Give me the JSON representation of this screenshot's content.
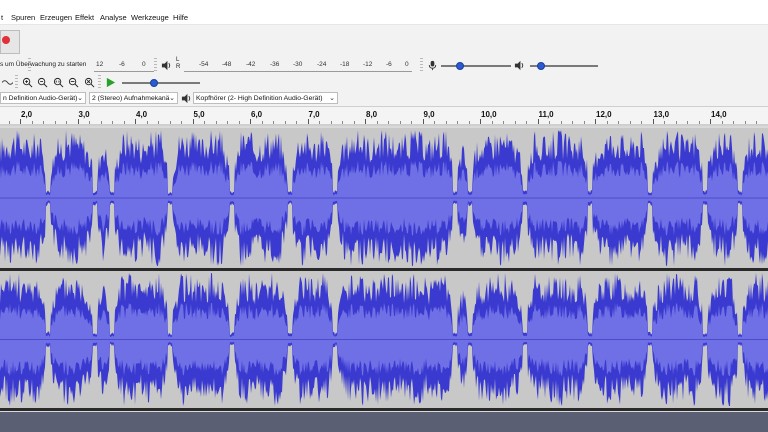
{
  "menu": {
    "items": [
      "t",
      "Spuren",
      "Erzeugen",
      "Effekt",
      "Analyse",
      "Werkzeuge",
      "Hilfe"
    ]
  },
  "meter": {
    "monitor_hint": "s um Überwachung zu starten",
    "record_ticks": [
      "12",
      "-6",
      "0"
    ],
    "playback_ticks": [
      "-54",
      "-48",
      "-42",
      "-36",
      "-30",
      "-24",
      "-18",
      "-12",
      "-6",
      "0"
    ],
    "lr_labels": [
      "L",
      "R"
    ]
  },
  "sliders": {
    "record_volume": 0.25,
    "playback_volume": 0.15,
    "play_speed": 0.4
  },
  "device": {
    "recording_device": "n Definition Audio-Gerät)",
    "channels": "2 (Stereo) Aufnahmekanä",
    "playback_device": "Kopfhörer (2- High Definition Audio-Gerät)"
  },
  "ruler": {
    "labels": [
      "2,0",
      "3,0",
      "4,0",
      "5,0",
      "6,0",
      "7,0",
      "8,0",
      "9,0",
      "10,0",
      "11,0",
      "12,0",
      "13,0",
      "14,0"
    ]
  },
  "colors": {
    "waveform": "#3a3ad0",
    "waveform_rms": "#6f6fe6",
    "record": "#e0303a",
    "play": "#2aa02a"
  },
  "icons": [
    "record-icon",
    "microphone-icon",
    "speaker-icon",
    "zoom-in-icon",
    "zoom-out-icon",
    "fit-selection-icon",
    "fit-project-icon",
    "zoom-toggle-icon",
    "play-at-speed-icon"
  ]
}
